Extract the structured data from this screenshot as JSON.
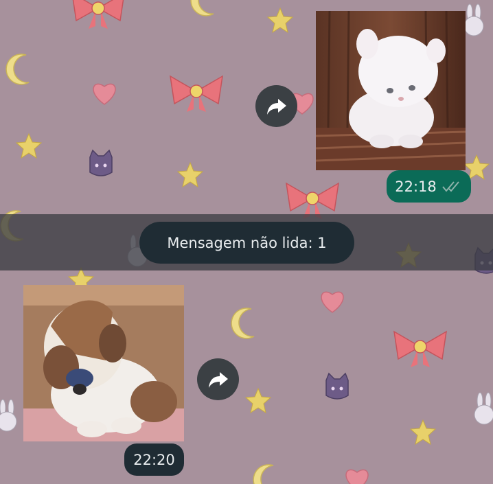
{
  "unread_banner": {
    "text": "Mensagem não lida: 1"
  },
  "messages": [
    {
      "direction": "outgoing",
      "content": "photo-kitten",
      "time": "22:18",
      "status": "read-double-check"
    },
    {
      "direction": "incoming",
      "content": "photo-puppy",
      "time": "22:20"
    }
  ],
  "icons": {
    "forward": "forward-arrow-icon",
    "read_receipt": "double-check-icon"
  },
  "colors": {
    "chat_background": "#a7919c",
    "outgoing_time_bubble": "#0b6b57",
    "incoming_time_bubble": "#1f2c34",
    "unread_pill": "#1f2c34",
    "forward_button": "#3b4044"
  }
}
